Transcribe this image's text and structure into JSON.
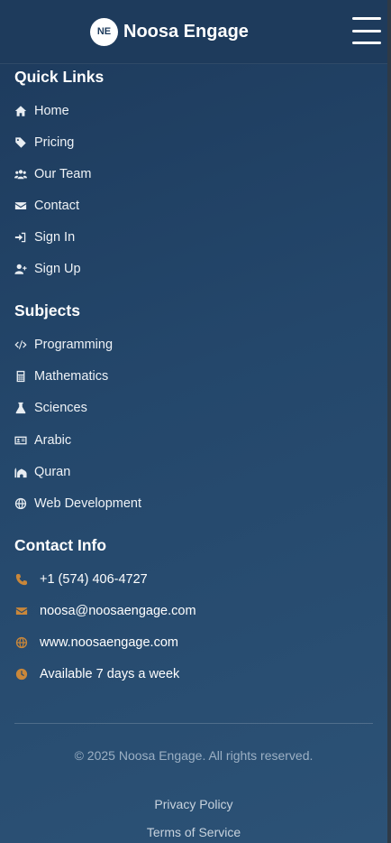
{
  "header": {
    "logo_initials": "NE",
    "brand_name": "Noosa Engage"
  },
  "quick_links": {
    "title": "Quick Links",
    "items": [
      {
        "label": "Home",
        "icon": "home-icon"
      },
      {
        "label": "Pricing",
        "icon": "tag-icon"
      },
      {
        "label": "Our Team",
        "icon": "users-icon"
      },
      {
        "label": "Contact",
        "icon": "envelope-icon"
      },
      {
        "label": "Sign In",
        "icon": "sign-in-icon"
      },
      {
        "label": "Sign Up",
        "icon": "user-plus-icon"
      }
    ]
  },
  "subjects": {
    "title": "Subjects",
    "items": [
      {
        "label": "Programming",
        "icon": "code-icon"
      },
      {
        "label": "Mathematics",
        "icon": "calculator-icon"
      },
      {
        "label": "Sciences",
        "icon": "flask-icon"
      },
      {
        "label": "Arabic",
        "icon": "id-card-icon"
      },
      {
        "label": "Quran",
        "icon": "mosque-icon"
      },
      {
        "label": "Web Development",
        "icon": "globe-icon"
      }
    ]
  },
  "contact_info": {
    "title": "Contact Info",
    "items": [
      {
        "label": "+1 (574) 406-4727",
        "icon": "phone-icon"
      },
      {
        "label": "noosa@noosaengage.com",
        "icon": "envelope-icon"
      },
      {
        "label": "www.noosaengage.com",
        "icon": "globe-icon"
      },
      {
        "label": "Available 7 days a week",
        "icon": "clock-icon"
      }
    ]
  },
  "footer": {
    "copyright": "© 2025 Noosa Engage. All rights reserved.",
    "privacy": "Privacy Policy",
    "terms": "Terms of Service"
  },
  "colors": {
    "header_bg": "#1e3b5c",
    "contact_icon": "#c9873a"
  }
}
